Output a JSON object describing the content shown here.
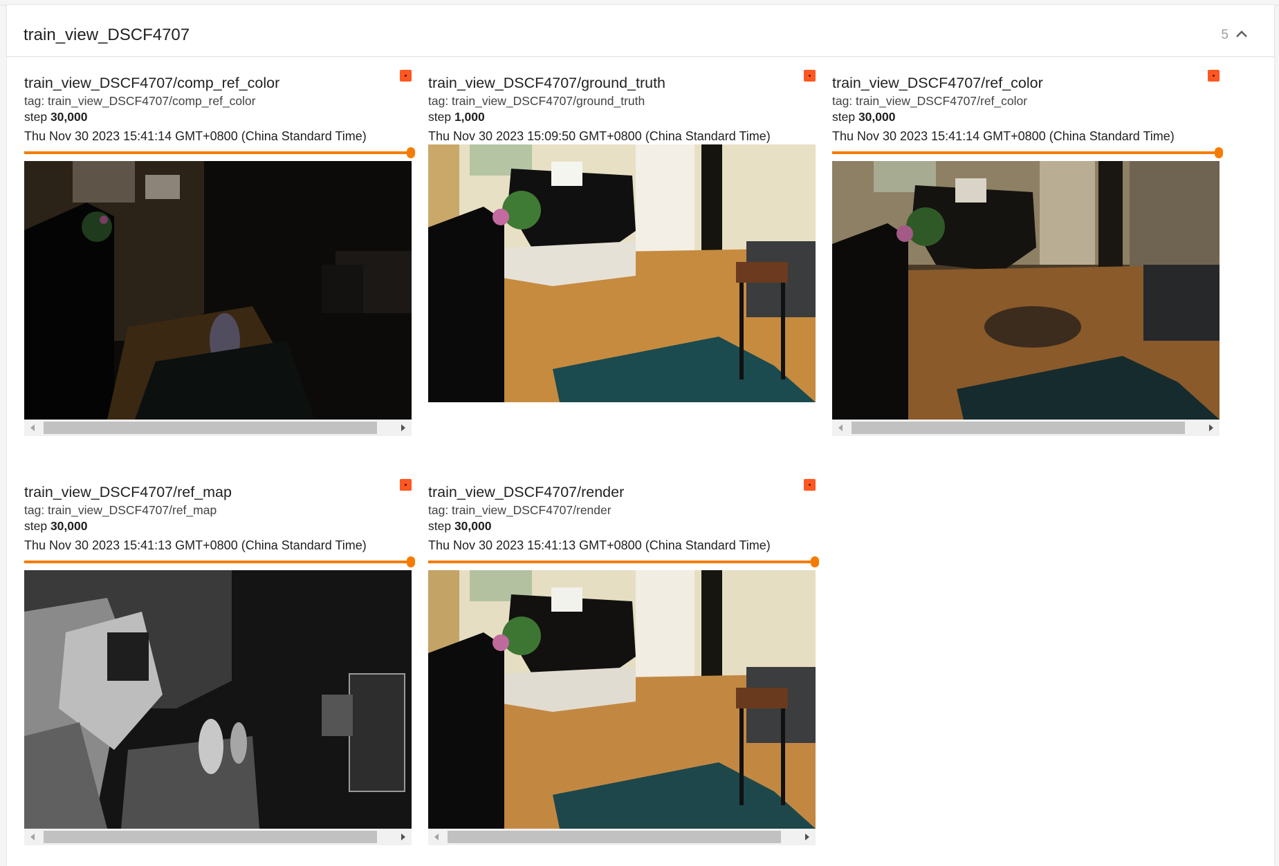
{
  "group": {
    "title": "train_view_DSCF4707",
    "count": "5"
  },
  "cards": [
    {
      "title": "train_view_DSCF4707/comp_ref_color",
      "tag": "tag: train_view_DSCF4707/comp_ref_color",
      "step_label": "step",
      "step_value": "30,000",
      "timestamp": "Thu Nov 30 2023 15:41:14 GMT+0800 (China Standard Time)"
    },
    {
      "title": "train_view_DSCF4707/ground_truth",
      "tag": "tag: train_view_DSCF4707/ground_truth",
      "step_label": "step",
      "step_value": "1,000",
      "timestamp": "Thu Nov 30 2023 15:09:50 GMT+0800 (China Standard Time)"
    },
    {
      "title": "train_view_DSCF4707/ref_color",
      "tag": "tag: train_view_DSCF4707/ref_color",
      "step_label": "step",
      "step_value": "30,000",
      "timestamp": "Thu Nov 30 2023 15:41:14 GMT+0800 (China Standard Time)"
    },
    {
      "title": "train_view_DSCF4707/ref_map",
      "tag": "tag: train_view_DSCF4707/ref_map",
      "step_label": "step",
      "step_value": "30,000",
      "timestamp": "Thu Nov 30 2023 15:41:13 GMT+0800 (China Standard Time)"
    },
    {
      "title": "train_view_DSCF4707/render",
      "tag": "tag: train_view_DSCF4707/render",
      "step_label": "step",
      "step_value": "30,000",
      "timestamp": "Thu Nov 30 2023 15:41:13 GMT+0800 (China Standard Time)"
    }
  ],
  "colors": {
    "accent_slider": "#f57c00",
    "pin": "#ff5722"
  }
}
